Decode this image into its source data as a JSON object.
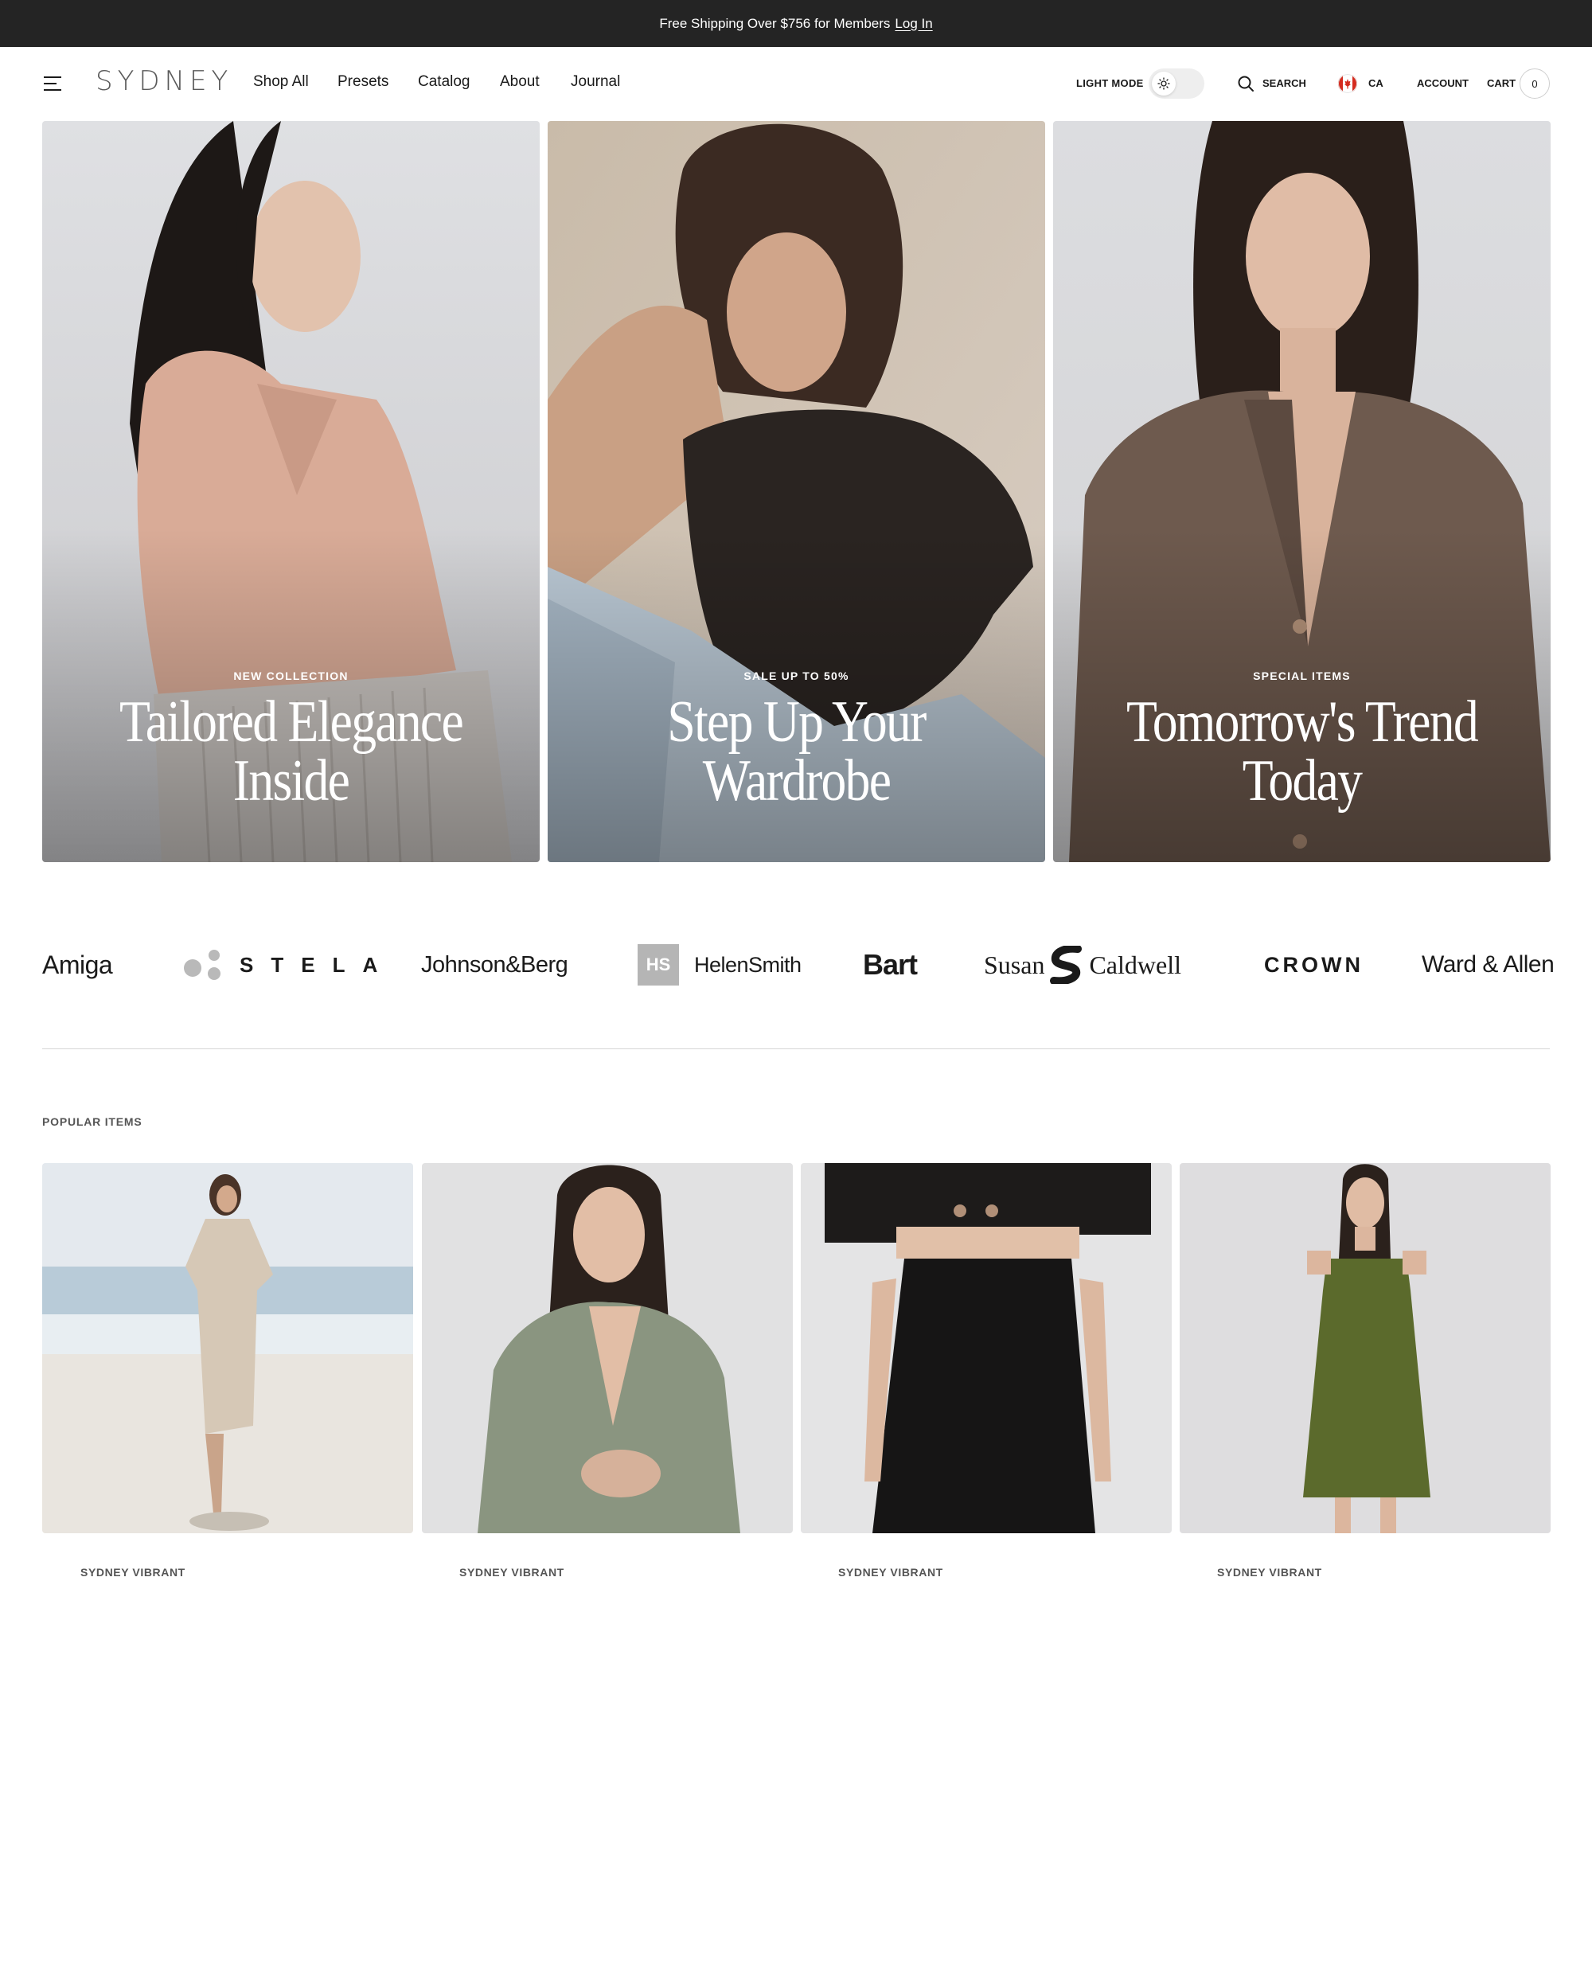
{
  "announcement": {
    "text": "Free Shipping Over $756 for Members",
    "link": "Log In"
  },
  "header": {
    "logo": "SYDNEY",
    "nav": [
      "Shop All",
      "Presets",
      "Catalog",
      "About",
      "Journal"
    ],
    "light_mode_label": "LIGHT MODE",
    "search_label": "SEARCH",
    "country_label": "CA",
    "account_label": "ACCOUNT",
    "cart_label": "CART",
    "cart_count": "0",
    "icons": [
      "menu-icon",
      "sun-icon",
      "search-icon",
      "canada-flag-icon"
    ]
  },
  "hero": [
    {
      "eyebrow": "NEW COLLECTION",
      "title_line1": "Tailored Elegance",
      "title_line2": "Inside"
    },
    {
      "eyebrow": "SALE UP TO 50%",
      "title_line1": "Step Up Your",
      "title_line2": "Wardrobe"
    },
    {
      "eyebrow": "SPECIAL ITEMS",
      "title_line1": "Tomorrow's Trend",
      "title_line2": "Today"
    }
  ],
  "brands": [
    "Amiga",
    "STELA",
    "Johnson&Berg",
    "HelenSmith",
    "Bart",
    "Susan",
    "Caldwell",
    "CROWN",
    "Ward & Allen"
  ],
  "brand_badge": "HS",
  "popular": {
    "label": "POPULAR ITEMS",
    "products": [
      {
        "vendor": "SYDNEY VIBRANT"
      },
      {
        "vendor": "SYDNEY VIBRANT"
      },
      {
        "vendor": "SYDNEY VIBRANT"
      },
      {
        "vendor": "SYDNEY VIBRANT"
      }
    ]
  }
}
